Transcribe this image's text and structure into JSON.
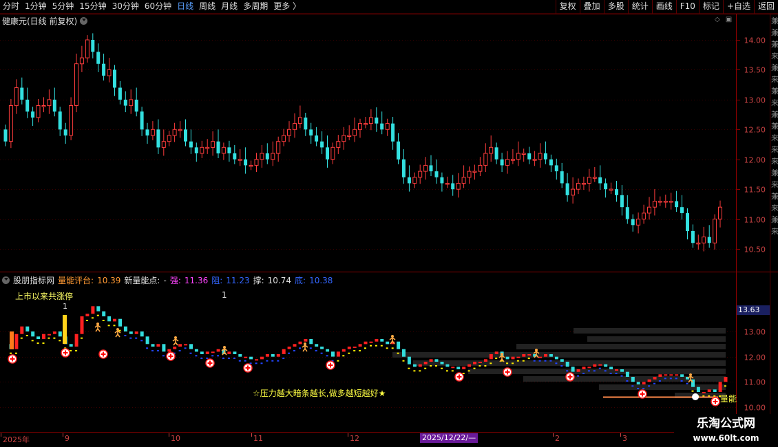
{
  "topbar": {
    "periods": [
      "分时",
      "1分钟",
      "5分钟",
      "15分钟",
      "30分钟",
      "60分钟",
      "日线",
      "周线",
      "月线",
      "多周期",
      "更多 〉"
    ],
    "active_period": "日线",
    "tools": [
      "复权",
      "叠加",
      "多股",
      "统计",
      "画线",
      "F10",
      "标记",
      "+自选",
      "返回"
    ]
  },
  "main_chart": {
    "title": "健康元(日线 前复权)",
    "price_ticks": [
      "14.00",
      "13.50",
      "13.00",
      "12.50",
      "12.00",
      "11.50",
      "11.00",
      "10.50"
    ],
    "colors": {
      "up": "#ff3c3c",
      "down": "#33e0e0",
      "grid": "#5a0000"
    }
  },
  "indicator": {
    "name": "股朋指标网",
    "score_label": "量能评台:",
    "score_value": "10.39",
    "new_point_label": "新量能点:",
    "new_point_value": "-",
    "strong_label": "强:",
    "strong_value": "11.36",
    "resist_label": "阻:",
    "resist_value": "11.23",
    "swing_label": "撑:",
    "swing_value": "10.74",
    "bottom_label": "底:",
    "bottom_value": "10.38",
    "limit_up_label": "上市以来共涨停",
    "limit_up_count": "1",
    "first_mark": "1",
    "price_ticks": [
      "13.00",
      "12.00",
      "11.00",
      "10.00"
    ],
    "current_price": "13.63",
    "slogan": "☆压力越大暗条越长,做多越短越好★",
    "energy_tag": "量能"
  },
  "right_edge_text": "兼兼兼来兼来兼来兼兼来来来兼来兼来兼来",
  "date_axis": {
    "labels": [
      "2025年",
      "9",
      "10",
      "11",
      "12",
      "2",
      "3"
    ],
    "cursor": "2025/12/22/—"
  },
  "watermark": {
    "cn": "乐淘公式网",
    "url": "www.60lt.com"
  },
  "chart_data": {
    "type": "candlestick",
    "title": "健康元(日线 前复权)",
    "ylim": [
      10.3,
      14.4
    ],
    "candles_open": [
      12.5,
      12.3,
      12.9,
      13.2,
      13.0,
      12.8,
      12.7,
      12.9,
      12.9,
      13.0,
      12.8,
      12.5,
      12.4,
      12.9,
      13.6,
      13.7,
      14.0,
      13.8,
      13.6,
      13.4,
      13.5,
      13.2,
      13.0,
      12.9,
      13.0,
      12.8,
      12.5,
      12.4,
      12.5,
      12.2,
      12.3,
      12.4,
      12.5,
      12.5,
      12.3,
      12.2,
      12.1,
      12.2,
      12.2,
      12.3,
      12.1,
      12.2,
      12.1,
      12.0,
      12.0,
      11.9,
      11.9,
      12.0,
      12.1,
      12.0,
      12.1,
      12.3,
      12.4,
      12.5,
      12.6,
      12.7,
      12.5,
      12.4,
      12.3,
      12.2,
      12.0,
      12.2,
      12.3,
      12.4,
      12.4,
      12.5,
      12.6,
      12.6,
      12.7,
      12.6,
      12.5,
      12.6,
      12.3,
      12.0,
      11.7,
      11.6,
      11.7,
      11.8,
      11.9,
      11.8,
      11.7,
      11.6,
      11.6,
      11.5,
      11.6,
      11.7,
      11.8,
      11.8,
      11.9,
      12.1,
      12.2,
      12.0,
      11.9,
      12.0,
      12.0,
      12.1,
      12.1,
      12.0,
      12.0,
      12.1,
      12.0,
      11.9,
      11.8,
      11.6,
      11.4,
      11.5,
      11.6,
      11.6,
      11.7,
      11.7,
      11.6,
      11.5,
      11.5,
      11.4,
      11.2,
      11.0,
      10.9,
      11.0,
      11.1,
      11.2,
      11.3,
      11.3,
      11.3,
      11.3,
      11.2,
      11.1,
      10.8,
      10.6,
      10.6,
      10.7,
      10.6,
      11.0
    ],
    "candles_close": [
      12.3,
      12.9,
      13.2,
      13.0,
      12.8,
      12.7,
      12.9,
      12.9,
      13.0,
      12.8,
      12.5,
      12.4,
      12.9,
      13.6,
      13.7,
      14.0,
      13.8,
      13.6,
      13.4,
      13.5,
      13.2,
      13.0,
      12.9,
      13.0,
      12.8,
      12.5,
      12.4,
      12.5,
      12.2,
      12.3,
      12.4,
      12.5,
      12.5,
      12.3,
      12.2,
      12.1,
      12.2,
      12.2,
      12.3,
      12.1,
      12.2,
      12.1,
      12.0,
      12.0,
      11.9,
      11.9,
      12.0,
      12.1,
      12.0,
      12.1,
      12.3,
      12.4,
      12.5,
      12.6,
      12.7,
      12.5,
      12.4,
      12.3,
      12.2,
      12.0,
      12.2,
      12.3,
      12.4,
      12.4,
      12.5,
      12.6,
      12.6,
      12.7,
      12.6,
      12.5,
      12.6,
      12.3,
      12.0,
      11.7,
      11.6,
      11.7,
      11.8,
      11.9,
      11.8,
      11.7,
      11.6,
      11.6,
      11.5,
      11.6,
      11.7,
      11.8,
      11.8,
      11.9,
      12.1,
      12.2,
      12.0,
      11.9,
      12.0,
      12.0,
      12.1,
      12.1,
      12.0,
      12.0,
      12.1,
      12.0,
      11.9,
      11.8,
      11.6,
      11.4,
      11.5,
      11.6,
      11.6,
      11.7,
      11.7,
      11.6,
      11.5,
      11.5,
      11.4,
      11.2,
      11.0,
      10.9,
      11.0,
      11.1,
      11.2,
      11.3,
      11.3,
      11.3,
      11.3,
      11.2,
      11.1,
      10.8,
      10.6,
      10.6,
      10.7,
      10.6,
      11.0,
      11.2
    ]
  }
}
